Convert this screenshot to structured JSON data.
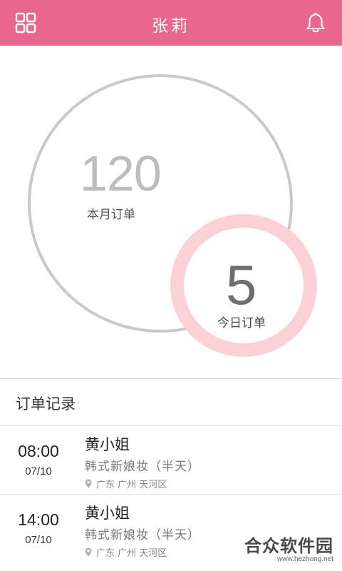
{
  "header": {
    "title": "张莉",
    "left_icon": "grid-menu-icon",
    "right_icon": "bell-icon",
    "bg_color": "#e9678e"
  },
  "stats": {
    "month": {
      "value": "120",
      "label": "本月订单"
    },
    "today": {
      "value": "5",
      "label": "今日订单"
    },
    "ring_color": "#c9c9c9",
    "today_ring_color": "#fbd1d6"
  },
  "orders": {
    "section_title": "订单记录",
    "items": [
      {
        "time": "08:00",
        "date": "07/10",
        "name": "黄小姐",
        "service": "韩式新娘妆（半天）",
        "location": "广东 广州 天河区"
      },
      {
        "time": "14:00",
        "date": "07/10",
        "name": "黄小姐",
        "service": "韩式新娘妆（半天）",
        "location": "广东 广州 天河区"
      }
    ]
  },
  "watermark": {
    "logo": "合众软件园",
    "url": "www.hezhong.net"
  }
}
